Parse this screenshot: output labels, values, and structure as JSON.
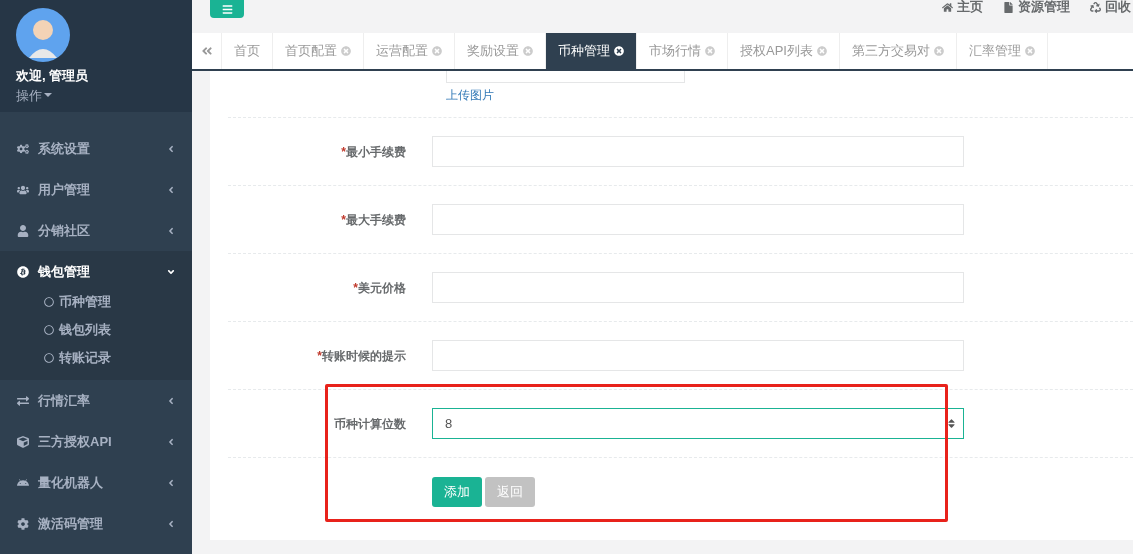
{
  "sidebar": {
    "user": {
      "welcome": "欢迎, 管理员",
      "menu": "操作"
    },
    "items": [
      {
        "label": "系统设置",
        "expanded": false
      },
      {
        "label": "用户管理",
        "expanded": false
      },
      {
        "label": "分销社区",
        "expanded": false
      },
      {
        "label": "钱包管理",
        "expanded": true,
        "children": [
          {
            "label": "币种管理"
          },
          {
            "label": "钱包列表"
          },
          {
            "label": "转账记录"
          }
        ]
      },
      {
        "label": "行情汇率",
        "expanded": false
      },
      {
        "label": "三方授权API",
        "expanded": false
      },
      {
        "label": "量化机器人",
        "expanded": false
      },
      {
        "label": "激活码管理",
        "expanded": false
      }
    ]
  },
  "header": {
    "links": [
      "主页",
      "资源管理",
      "回收"
    ]
  },
  "tabs": [
    {
      "label": "首页",
      "selected": false,
      "closable": false
    },
    {
      "label": "首页配置",
      "selected": false,
      "closable": true
    },
    {
      "label": "运营配置",
      "selected": false,
      "closable": true
    },
    {
      "label": "奖励设置",
      "selected": false,
      "closable": true
    },
    {
      "label": "币种管理",
      "selected": true,
      "closable": true
    },
    {
      "label": "市场行情",
      "selected": false,
      "closable": true
    },
    {
      "label": "授权API列表",
      "selected": false,
      "closable": true
    },
    {
      "label": "第三方交易对",
      "selected": false,
      "closable": true
    },
    {
      "label": "汇率管理",
      "selected": false,
      "closable": true
    }
  ],
  "form": {
    "upload_link": "上传图片",
    "required_mark": "*",
    "fields": [
      {
        "label": "最小手续费",
        "required": true,
        "kind": "text"
      },
      {
        "label": "最大手续费",
        "required": true,
        "kind": "text"
      },
      {
        "label": "美元价格",
        "required": true,
        "kind": "text"
      },
      {
        "label": "转账时候的提示",
        "required": true,
        "kind": "text"
      },
      {
        "label": "币种计算位数",
        "required": false,
        "kind": "number",
        "value": "8"
      }
    ],
    "buttons": [
      {
        "label": "添加",
        "kind": "primary"
      },
      {
        "label": "返回",
        "kind": "default"
      }
    ]
  }
}
